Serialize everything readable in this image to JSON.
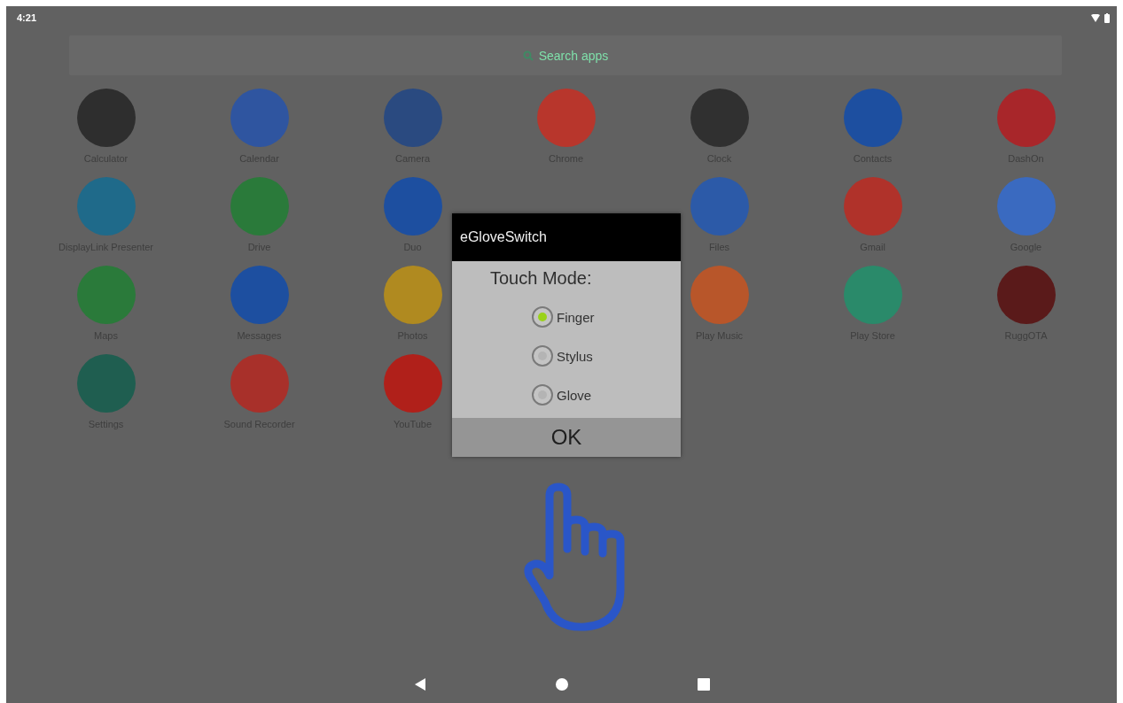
{
  "status_bar": {
    "time": "4:21"
  },
  "search": {
    "placeholder": "Search apps"
  },
  "app_rows": [
    [
      {
        "label": "Calculator",
        "color": "#2e2e2e"
      },
      {
        "label": "Calendar",
        "color": "#2f55a0"
      },
      {
        "label": "Camera",
        "color": "#2a4a80"
      },
      {
        "label": "Chrome",
        "color": "#b8362c"
      },
      {
        "label": "Clock",
        "color": "#303030"
      },
      {
        "label": "Contacts",
        "color": "#1d4fa0"
      },
      {
        "label": "DashOn",
        "color": "#a8262a"
      }
    ],
    [
      {
        "label": "DisplayLink Presenter",
        "color": "#1f6a8a"
      },
      {
        "label": "Drive",
        "color": "#2a7a3a"
      },
      {
        "label": "Duo",
        "color": "#1d4fa0"
      },
      null,
      {
        "label": "Files",
        "color": "#2c5aa8"
      },
      {
        "label": "Gmail",
        "color": "#b0322a"
      },
      {
        "label": "Google",
        "color": "#3a6ac0"
      }
    ],
    [
      {
        "label": "Maps",
        "color": "#2a7a3a"
      },
      {
        "label": "Messages",
        "color": "#1d4fa0"
      },
      {
        "label": "Photos",
        "color": "#b08a20"
      },
      null,
      {
        "label": "Play Music",
        "color": "#b8562a"
      },
      {
        "label": "Play Store",
        "color": "#2a8a6a"
      },
      {
        "label": "RuggOTA",
        "color": "#5a1a1a"
      }
    ],
    [
      {
        "label": "Settings",
        "color": "#1f5e50"
      },
      {
        "label": "Sound Recorder",
        "color": "#a8302a"
      },
      {
        "label": "YouTube",
        "color": "#b0201a"
      }
    ]
  ],
  "dialog": {
    "title": "eGloveSwitch",
    "heading": "Touch Mode:",
    "options": [
      {
        "label": "Finger",
        "selected": true
      },
      {
        "label": "Stylus",
        "selected": false
      },
      {
        "label": "Glove",
        "selected": false
      }
    ],
    "button": "OK"
  }
}
